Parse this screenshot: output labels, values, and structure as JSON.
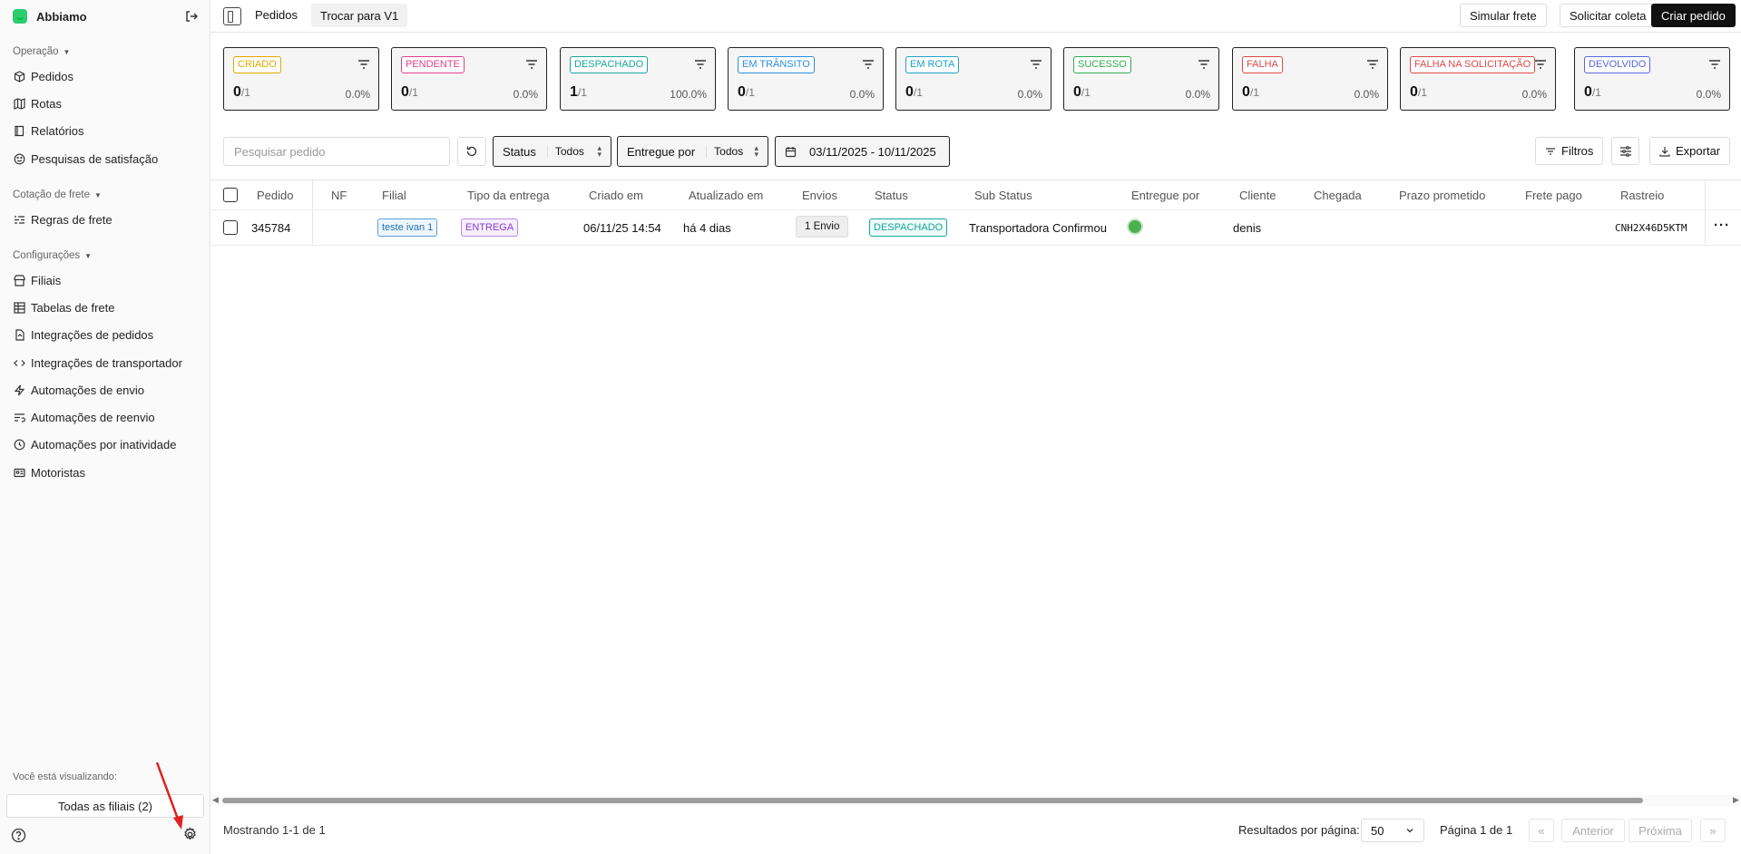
{
  "brand": {
    "name": "Abbiamo"
  },
  "sidebar": {
    "sections": [
      {
        "title": "Operação",
        "items": [
          "Pedidos",
          "Rotas",
          "Relatórios",
          "Pesquisas de satisfação"
        ]
      },
      {
        "title": "Cotação de frete",
        "items": [
          "Regras de frete"
        ]
      },
      {
        "title": "Configurações",
        "items": [
          "Filiais",
          "Tabelas de frete",
          "Integrações de pedidos",
          "Integrações de transportador",
          "Automações de envio",
          "Automações de reenvio",
          "Automações por inatividade",
          "Motoristas"
        ]
      }
    ],
    "viewing_label": "Você está visualizando:",
    "branch_button": "Todas as filiais (2)"
  },
  "topbar": {
    "title": "Pedidos",
    "switch_label": "Trocar para V1",
    "simulate_label": "Simular frete",
    "pickup_label": "Solicitar coleta",
    "create_label": "Criar pedido"
  },
  "cards": [
    {
      "label": "CRIADO",
      "count": "0",
      "total": "/1",
      "pct": "0.0%",
      "color": "#e0a800"
    },
    {
      "label": "PENDENTE",
      "count": "0",
      "total": "/1",
      "pct": "0.0%",
      "color": "#e0408a"
    },
    {
      "label": "DESPACHADO",
      "count": "1",
      "total": "/1",
      "pct": "100.0%",
      "color": "#14a89a"
    },
    {
      "label": "EM TRÂNSITO",
      "count": "0",
      "total": "/1",
      "pct": "0.0%",
      "color": "#2a8de0"
    },
    {
      "label": "EM ROTA",
      "count": "0",
      "total": "/1",
      "pct": "0.0%",
      "color": "#1aa3c8"
    },
    {
      "label": "SUCESSO",
      "count": "0",
      "total": "/1",
      "pct": "0.0%",
      "color": "#2eaa4f"
    },
    {
      "label": "FALHA",
      "count": "0",
      "total": "/1",
      "pct": "0.0%",
      "color": "#e04848"
    },
    {
      "label": "FALHA NA SOLICITAÇÃO",
      "count": "0",
      "total": "/1",
      "pct": "0.0%",
      "color": "#e04848"
    },
    {
      "label": "DEVOLVIDO",
      "count": "0",
      "total": "/1",
      "pct": "0.0%",
      "color": "#5566e0"
    }
  ],
  "filters": {
    "search_placeholder": "Pesquisar pedido",
    "status_label": "Status",
    "status_value": "Todos",
    "delivered_by_label": "Entregue por",
    "delivered_by_value": "Todos",
    "date_range": "03/11/2025 - 10/11/2025",
    "filters_label": "Filtros",
    "export_label": "Exportar"
  },
  "table": {
    "columns": [
      "Pedido",
      "NF",
      "Filial",
      "Tipo da entrega",
      "Criado em",
      "Atualizado em",
      "Envios",
      "Status",
      "Sub Status",
      "Entregue por",
      "Cliente",
      "Chegada",
      "Prazo prometido",
      "Frete pago",
      "Rastreio"
    ],
    "rows": [
      {
        "pedido": "345784",
        "nf": "",
        "filial": "teste ivan 1",
        "tipo": "ENTREGA",
        "criado": "06/11/25 14:54",
        "atualizado": "há 4 dias",
        "envios": "1 Envio",
        "status": "DESPACHADO",
        "sub_status": "Transportadora Confirmou",
        "cliente": "denis",
        "rastreio": "CNH2X46D5KTM"
      }
    ]
  },
  "footer": {
    "showing": "Mostrando 1-1 de 1",
    "rpp_label": "Resultados por página:",
    "rpp_value": "50",
    "page_info": "Página 1 de 1",
    "first": "«",
    "prev": "Anterior",
    "next": "Próxima",
    "last": "»"
  }
}
